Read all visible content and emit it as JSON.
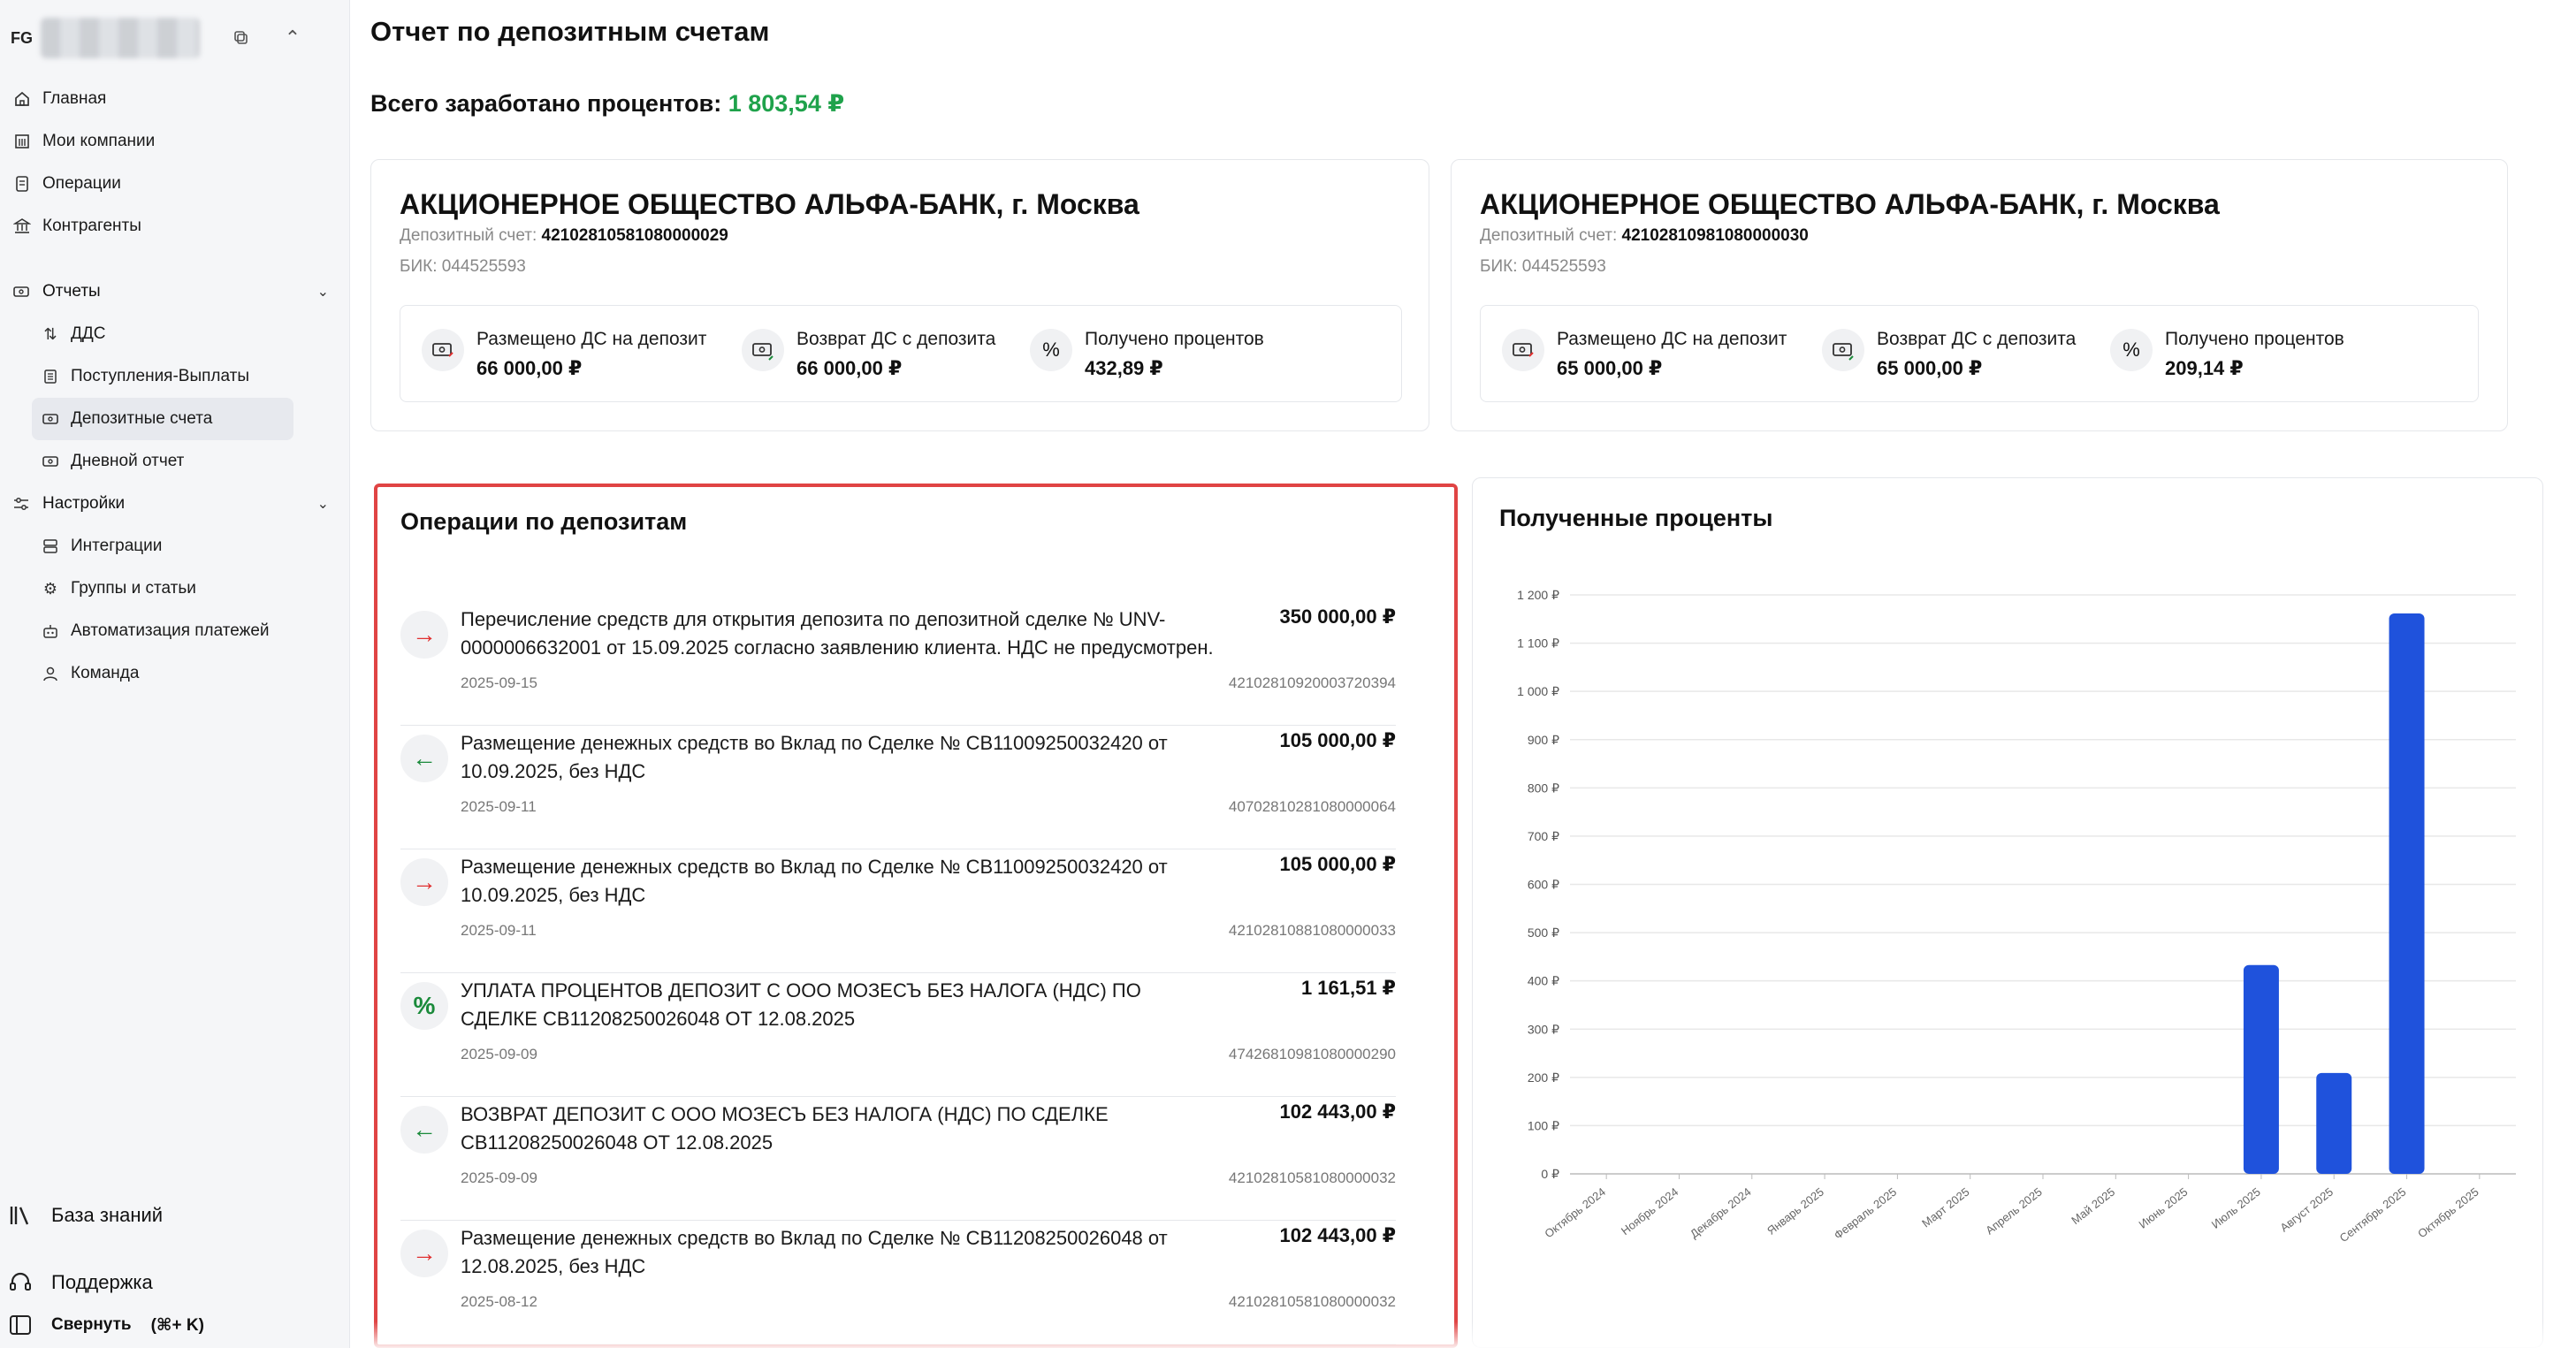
{
  "org": {
    "initials": "FG"
  },
  "nav": {
    "home": "Главная",
    "companies": "Мои компании",
    "operations": "Операции",
    "counterparties": "Контрагенты",
    "reports": "Отчеты",
    "dds": "ДДС",
    "inflows": "Поступления-Выплаты",
    "deposits": "Депозитные счета",
    "daily": "Дневной отчет",
    "settings": "Настройки",
    "integrations": "Интеграции",
    "groups": "Группы и статьи",
    "automation": "Автоматизация платежей",
    "team": "Команда"
  },
  "bottom": {
    "knowledge": "База знаний",
    "support": "Поддержка",
    "collapse": "Свернуть",
    "collapse_shortcut": "(⌘+ K)"
  },
  "page": {
    "title": "Отчет по депозитным счетам",
    "total_label": "Всего заработано процентов:",
    "total_value": "1 803,54 ₽"
  },
  "accounts": [
    {
      "bank": "АКЦИОНЕРНОЕ ОБЩЕСТВО АЛЬФА-БАНК, г. Москва",
      "account_label": "Депозитный счет:",
      "account": "42102810581080000029",
      "bik": "БИК: 044525593",
      "placed_label": "Размещено ДС на депозит",
      "placed": "66 000,00 ₽",
      "returned_label": "Возврат ДС с депозита",
      "returned": "66 000,00 ₽",
      "interest_label": "Получено процентов",
      "interest": "432,89 ₽"
    },
    {
      "bank": "АКЦИОНЕРНОЕ ОБЩЕСТВО АЛЬФА-БАНК, г. Москва",
      "account_label": "Депозитный счет:",
      "account": "42102810981080000030",
      "bik": "БИК: 044525593",
      "placed_label": "Размещено ДС на депозит",
      "placed": "65 000,00 ₽",
      "returned_label": "Возврат ДС с депозита",
      "returned": "65 000,00 ₽",
      "interest_label": "Получено процентов",
      "interest": "209,14 ₽"
    }
  ],
  "operations": {
    "title": "Операции по депозитам",
    "items": [
      {
        "type": "out",
        "desc": "Перечисление средств для открытия депозита по депозитной сделке № UNV-0000006632001 от 15.09.2025 согласно заявлению клиента. НДС не предусмотрен.",
        "amount": "350 000,00 ₽",
        "date": "2025-09-15",
        "account": "42102810920003720394"
      },
      {
        "type": "in",
        "desc": "Размещение денежных средств во Вклад по Сделке № CB11009250032420 от 10.09.2025, без НДС",
        "amount": "105 000,00 ₽",
        "date": "2025-09-11",
        "account": "40702810281080000064"
      },
      {
        "type": "out",
        "desc": "Размещение денежных средств во Вклад по Сделке № CB11009250032420 от 10.09.2025, без НДС",
        "amount": "105 000,00 ₽",
        "date": "2025-09-11",
        "account": "42102810881080000033"
      },
      {
        "type": "interest",
        "desc": "УПЛАТА ПРОЦЕНТОВ ДЕПОЗИТ С ООО МОЗЕСЪ БЕЗ НАЛОГА (НДС) ПО СДЕЛКЕ CB11208250026048 ОТ 12.08.2025",
        "amount": "1 161,51 ₽",
        "date": "2025-09-09",
        "account": "47426810981080000290"
      },
      {
        "type": "in",
        "desc": "ВОЗВРАТ ДЕПОЗИТ С ООО МОЗЕСЪ БЕЗ НАЛОГА (НДС) ПО СДЕЛКЕ CB11208250026048 ОТ 12.08.2025",
        "amount": "102 443,00 ₽",
        "date": "2025-09-09",
        "account": "42102810581080000032"
      },
      {
        "type": "out",
        "desc": "Размещение денежных средств во Вклад по Сделке № CB11208250026048 от 12.08.2025, без НДС",
        "amount": "102 443,00 ₽",
        "date": "2025-08-12",
        "account": "42102810581080000032"
      }
    ]
  },
  "chart_data": {
    "type": "bar",
    "title": "Полученные проценты",
    "categories": [
      "Октябрь 2024",
      "Ноябрь 2024",
      "Декабрь 2024",
      "Январь 2025",
      "Февраль 2025",
      "Март 2025",
      "Апрель 2025",
      "Май 2025",
      "Июнь 2025",
      "Июль 2025",
      "Август 2025",
      "Сентябрь 2025",
      "Октябрь 2025"
    ],
    "values": [
      0,
      0,
      0,
      0,
      0,
      0,
      0,
      0,
      0,
      432.89,
      209.14,
      1161.51,
      0
    ],
    "ylim": [
      0,
      1200
    ],
    "yticks": [
      "0 ₽",
      "100 ₽",
      "200 ₽",
      "300 ₽",
      "400 ₽",
      "500 ₽",
      "600 ₽",
      "700 ₽",
      "800 ₽",
      "900 ₽",
      "1 000 ₽",
      "1 100 ₽",
      "1 200 ₽"
    ],
    "bar_color": "#1f52dc",
    "grid": true
  },
  "colors": {
    "accent_green": "#1fa24b",
    "out_red": "#e03030",
    "in_green": "#1a8a3a",
    "highlight": "#e04444"
  }
}
